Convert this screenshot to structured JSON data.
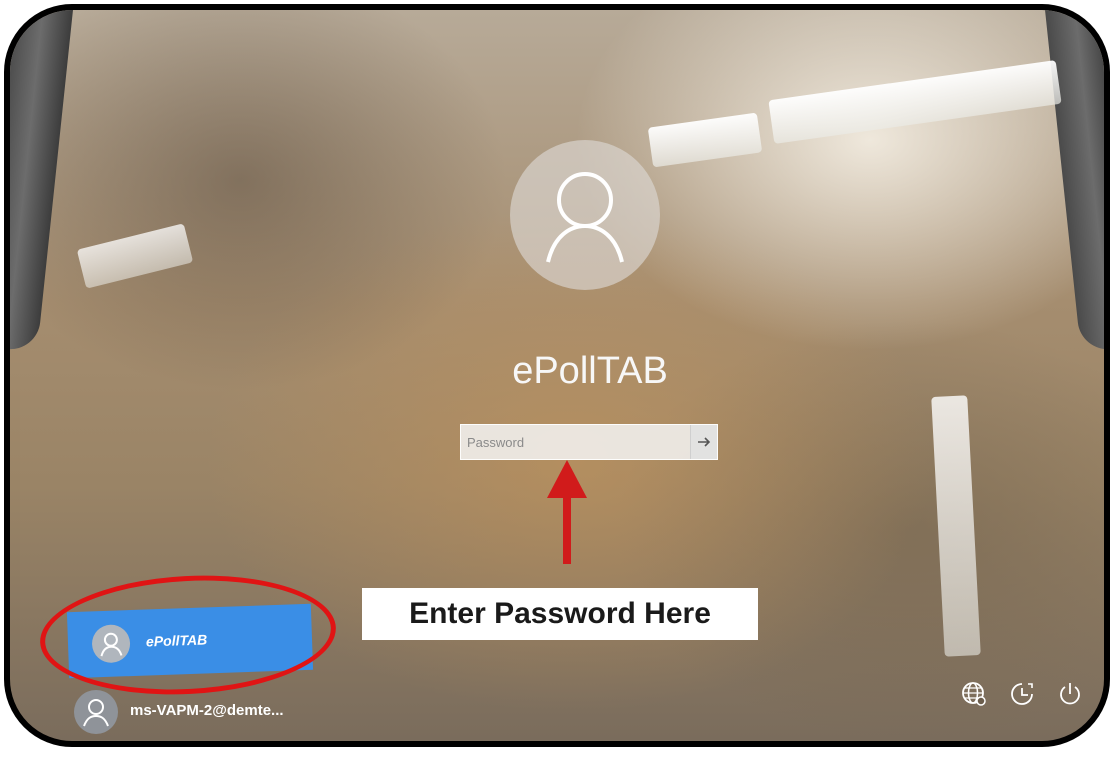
{
  "lock_screen": {
    "selected_user": "ePollTAB",
    "password": {
      "placeholder": "Password",
      "value": ""
    }
  },
  "annotation": {
    "callout_text": "Enter Password Here",
    "arrow_color": "#d11b1b",
    "ring_color": "#e01414"
  },
  "user_list": [
    {
      "name": "ePollTAB",
      "selected": true
    },
    {
      "name": "ms-VAPM-2@demte...",
      "selected": false
    }
  ],
  "system_icons": [
    "network-icon",
    "ease-of-access-icon",
    "power-icon"
  ],
  "colors": {
    "selected_tile": "#3a8ee6",
    "callout_bg": "#ffffff"
  }
}
